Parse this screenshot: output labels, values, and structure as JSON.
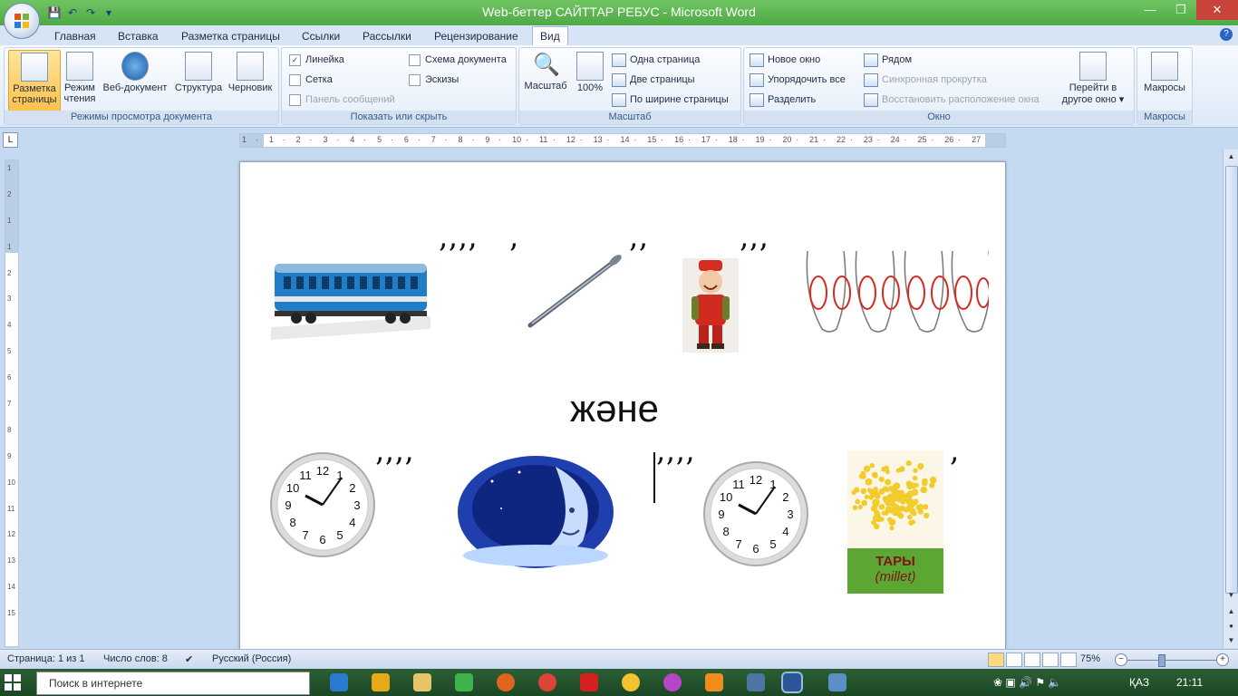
{
  "window": {
    "title": "Web-беттер САЙТТАР РЕБУС - Microsoft Word",
    "controls": {
      "minimize": "—",
      "restore": "❐",
      "close": "✕"
    }
  },
  "qat": {
    "save": "💾",
    "undo": "↶",
    "redo": "↷",
    "customize": "▾"
  },
  "tabs": [
    "Главная",
    "Вставка",
    "Разметка страницы",
    "Ссылки",
    "Рассылки",
    "Рецензирование",
    "Вид"
  ],
  "active_tab": "Вид",
  "ribbon": {
    "views": {
      "label": "Режимы просмотра документа",
      "buttons": [
        "Разметка страницы",
        "Режим чтения",
        "Веб-документ",
        "Структура",
        "Черновик"
      ],
      "btn0_l1": "Разметка",
      "btn0_l2": "страницы",
      "btn1_l1": "Режим",
      "btn1_l2": "чтения"
    },
    "show": {
      "label": "Показать или скрыть",
      "ruler": "Линейка",
      "grid": "Сетка",
      "msgbar": "Панель сообщений",
      "docmap": "Схема документа",
      "thumbs": "Эскизы"
    },
    "zoom": {
      "label": "Масштаб",
      "zoom_btn": "Масштаб",
      "pct_btn": "100%",
      "one_page": "Одна страница",
      "two_pages": "Две страницы",
      "page_width": "По ширине страницы"
    },
    "window": {
      "label": "Окно",
      "new_window": "Новое окно",
      "arrange_all": "Упорядочить все",
      "split": "Разделить",
      "side_by_side": "Рядом",
      "sync_scroll": "Синхронная прокрутка",
      "reset_pos": "Восстановить расположение окна",
      "switch_l1": "Перейти в",
      "switch_l2": "другое окно ▾"
    },
    "macros": {
      "label": "Макросы",
      "btn": "Макросы"
    }
  },
  "ruler": {
    "h_ticks": [
      "1",
      "·",
      "1",
      "·",
      "2",
      "·",
      "3",
      "·",
      "4",
      "·",
      "5",
      "·",
      "6",
      "·",
      "7",
      "·",
      "8",
      "·",
      "9",
      "·",
      "10",
      "·",
      "11",
      "·",
      "12",
      "·",
      "13",
      "·",
      "14",
      "·",
      "15",
      "·",
      "16",
      "·",
      "17",
      "·",
      "18",
      "·",
      "19",
      "·",
      "20",
      "·",
      "21",
      "·",
      "22",
      "·",
      "23",
      "·",
      "24",
      "·",
      "25",
      "·",
      "26",
      "·",
      "27"
    ],
    "v_ticks": [
      "1",
      "2",
      "1",
      "1",
      "2",
      "3",
      "4",
      "5",
      "6",
      "7",
      "8",
      "9",
      "10",
      "11",
      "12",
      "13",
      "14",
      "15"
    ],
    "corner": "L"
  },
  "document": {
    "commas_row1a": "’’’’",
    "commas_row1b": "’",
    "commas_row1c": "’’",
    "commas_row1d": "’’’",
    "middle_word": "және",
    "commas_row2a": "’’’’",
    "commas_row2b": "’’’’",
    "commas_row2c": "’",
    "millet_title": "ТАРЫ",
    "millet_sub": "(millet)",
    "clock_numbers": [
      "12",
      "1",
      "2",
      "3",
      "4",
      "5",
      "6",
      "7",
      "8",
      "9",
      "10",
      "11"
    ]
  },
  "statusbar": {
    "page": "Страница: 1 из 1",
    "words": "Число слов: 8",
    "language": "Русский (Россия)",
    "zoom": "75%",
    "minus": "−",
    "plus": "+"
  },
  "taskbar": {
    "search_placeholder": "Поиск в интернете",
    "lang": "ҚАЗ",
    "time": "21:11"
  },
  "colors": {
    "title_green": "#4ea944",
    "millet_bg": "#5ca634",
    "millet_text": "#7a1714",
    "moon_blue": "#1f3fae"
  }
}
